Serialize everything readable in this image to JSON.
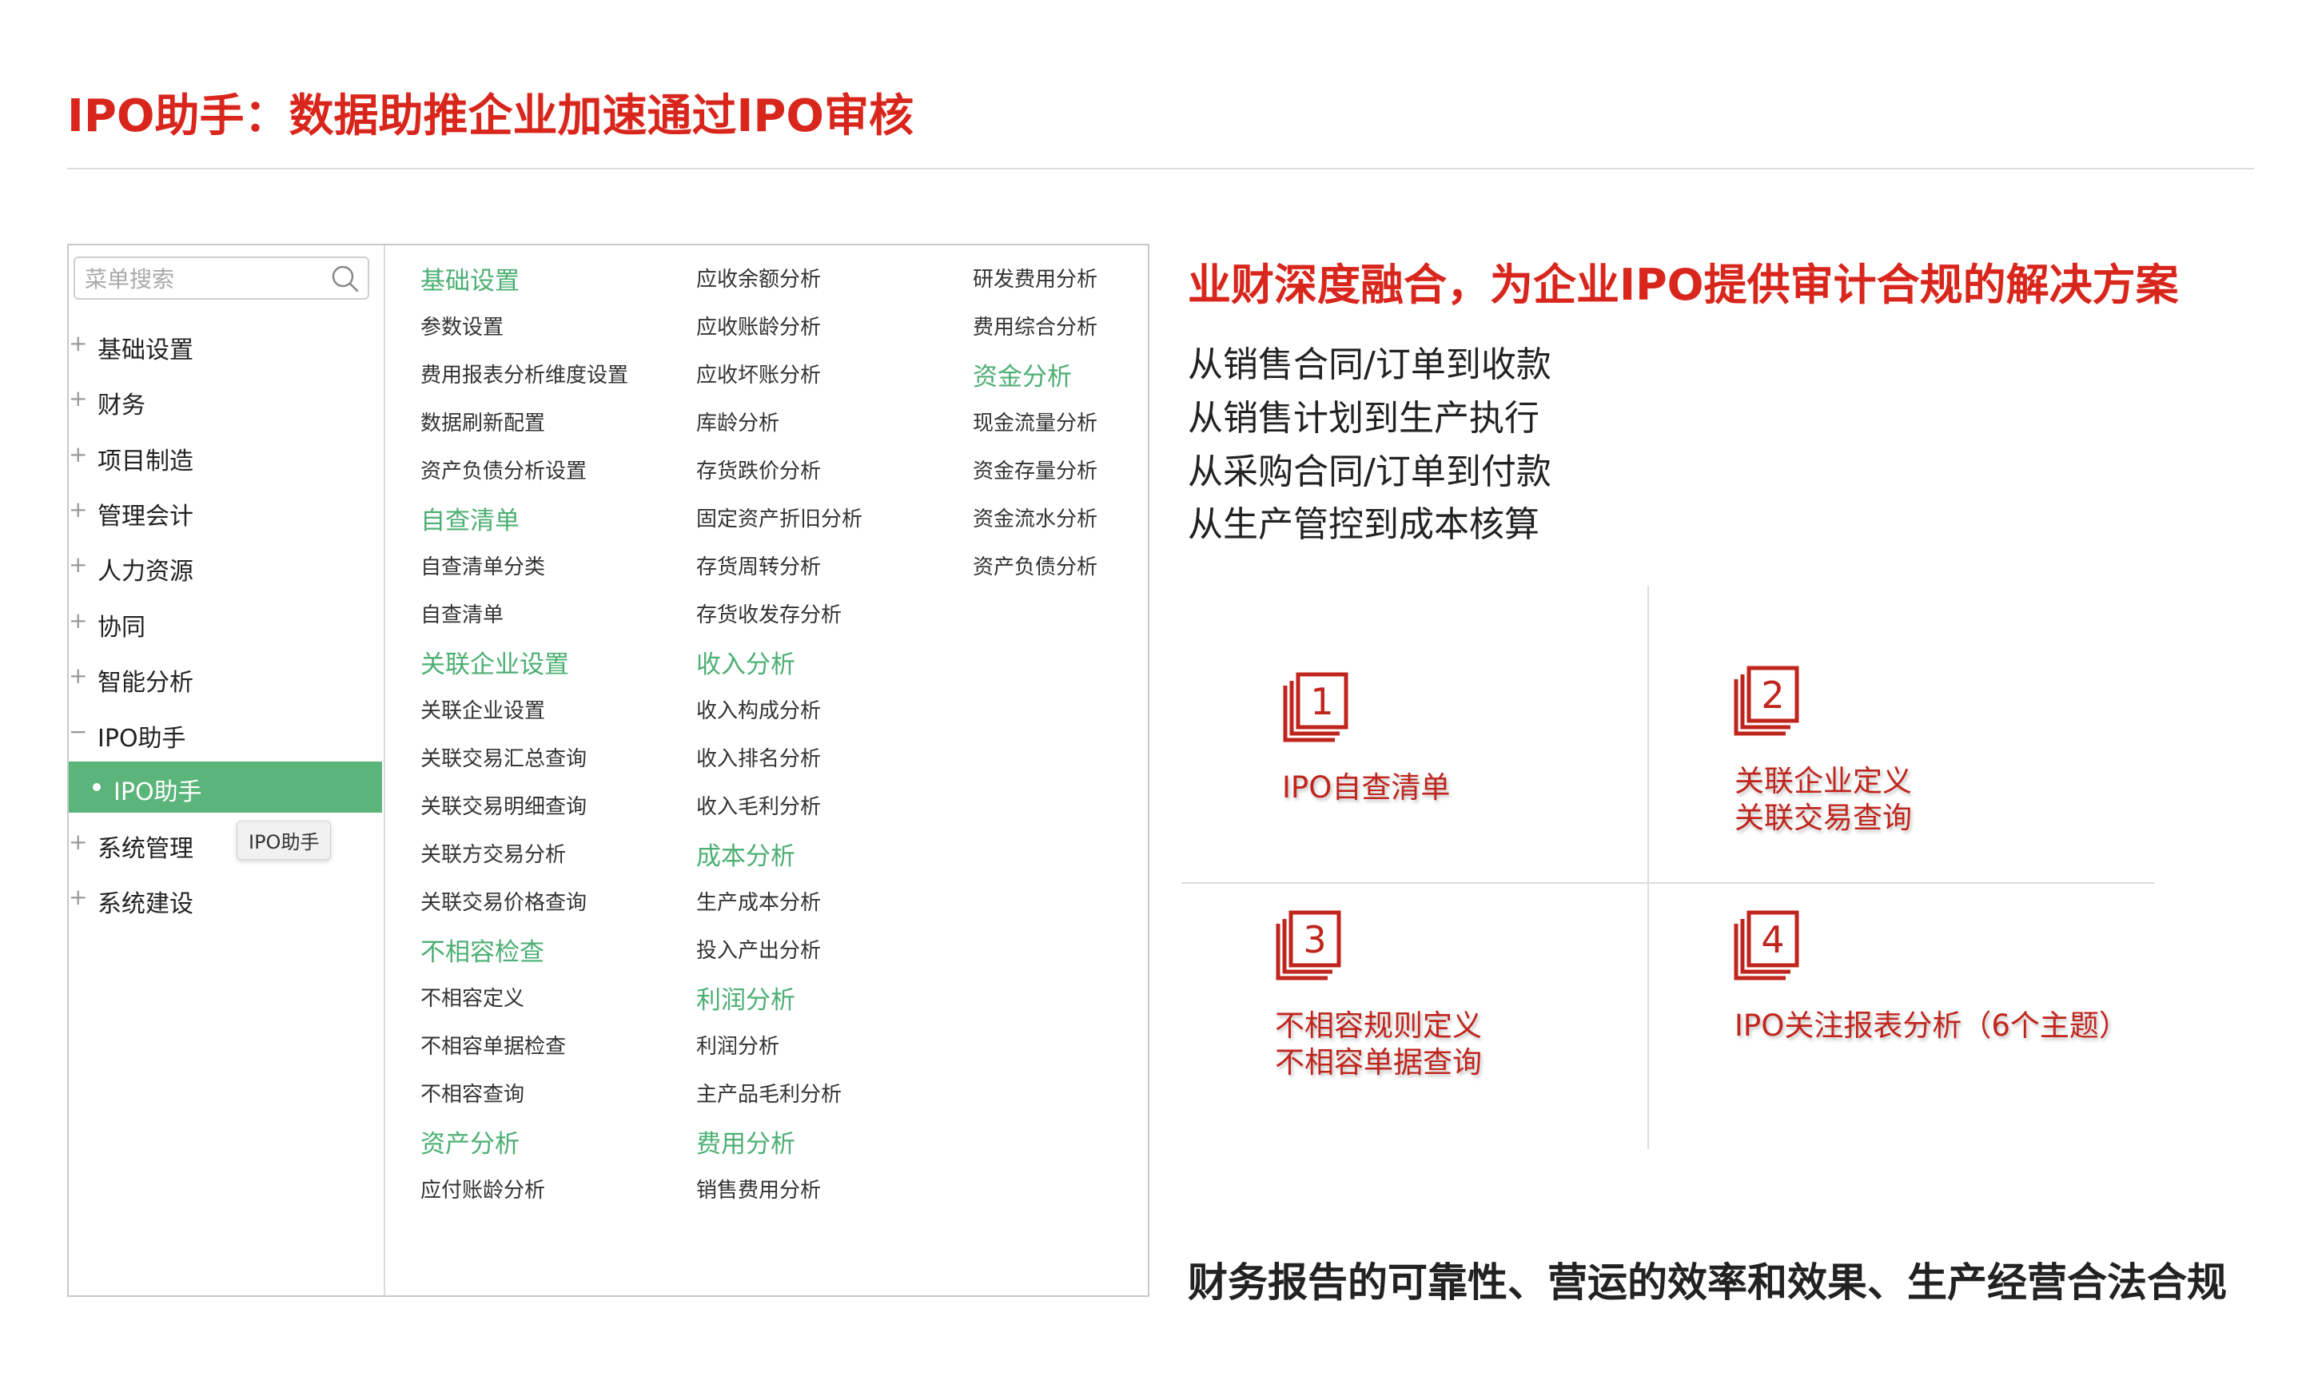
{
  "header": {
    "title": "IPO助手：数据助推企业加速通过IPO审核"
  },
  "sidebar": {
    "search_placeholder": "菜单搜索",
    "items": [
      {
        "prefix": "+",
        "label": "基础设置"
      },
      {
        "prefix": "+",
        "label": "财务"
      },
      {
        "prefix": "+",
        "label": "项目制造"
      },
      {
        "prefix": "+",
        "label": "管理会计"
      },
      {
        "prefix": "+",
        "label": "人力资源"
      },
      {
        "prefix": "+",
        "label": "协同"
      },
      {
        "prefix": "+",
        "label": "智能分析"
      },
      {
        "prefix": "−",
        "label": "IPO助手"
      },
      {
        "prefix": "+",
        "label": "系统管理"
      },
      {
        "prefix": "+",
        "label": "系统建设"
      }
    ],
    "active_sub": "IPO助手",
    "tooltip": "IPO助手"
  },
  "menu": {
    "col1": [
      {
        "t": "h",
        "label": "基础设置"
      },
      {
        "t": "n",
        "label": "参数设置"
      },
      {
        "t": "n",
        "label": "费用报表分析维度设置"
      },
      {
        "t": "n",
        "label": "数据刷新配置"
      },
      {
        "t": "n",
        "label": "资产负债分析设置"
      },
      {
        "t": "h",
        "label": "自查清单"
      },
      {
        "t": "n",
        "label": "自查清单分类"
      },
      {
        "t": "n",
        "label": "自查清单"
      },
      {
        "t": "h",
        "label": "关联企业设置"
      },
      {
        "t": "n",
        "label": "关联企业设置"
      },
      {
        "t": "n",
        "label": "关联交易汇总查询"
      },
      {
        "t": "n",
        "label": "关联交易明细查询"
      },
      {
        "t": "n",
        "label": "关联方交易分析"
      },
      {
        "t": "n",
        "label": "关联交易价格查询"
      },
      {
        "t": "h",
        "label": "不相容检查"
      },
      {
        "t": "n",
        "label": "不相容定义"
      },
      {
        "t": "n",
        "label": "不相容单据检查"
      },
      {
        "t": "n",
        "label": "不相容查询"
      },
      {
        "t": "h",
        "label": "资产分析"
      },
      {
        "t": "n",
        "label": "应付账龄分析"
      }
    ],
    "col2": [
      {
        "t": "n",
        "label": "应收余额分析"
      },
      {
        "t": "n",
        "label": "应收账龄分析"
      },
      {
        "t": "n",
        "label": "应收坏账分析"
      },
      {
        "t": "n",
        "label": "库龄分析"
      },
      {
        "t": "n",
        "label": "存货跌价分析"
      },
      {
        "t": "n",
        "label": "固定资产折旧分析"
      },
      {
        "t": "n",
        "label": "存货周转分析"
      },
      {
        "t": "n",
        "label": "存货收发存分析"
      },
      {
        "t": "h",
        "label": "收入分析"
      },
      {
        "t": "n",
        "label": "收入构成分析"
      },
      {
        "t": "n",
        "label": "收入排名分析"
      },
      {
        "t": "n",
        "label": "收入毛利分析"
      },
      {
        "t": "h",
        "label": "成本分析"
      },
      {
        "t": "n",
        "label": "生产成本分析"
      },
      {
        "t": "n",
        "label": "投入产出分析"
      },
      {
        "t": "h",
        "label": "利润分析"
      },
      {
        "t": "n",
        "label": "利润分析"
      },
      {
        "t": "n",
        "label": "主产品毛利分析"
      },
      {
        "t": "h",
        "label": "费用分析"
      },
      {
        "t": "n",
        "label": "销售费用分析"
      }
    ],
    "col3": [
      {
        "t": "n",
        "label": "研发费用分析"
      },
      {
        "t": "n",
        "label": "费用综合分析"
      },
      {
        "t": "h",
        "label": "资金分析"
      },
      {
        "t": "n",
        "label": "现金流量分析"
      },
      {
        "t": "n",
        "label": "资金存量分析"
      },
      {
        "t": "n",
        "label": "资金流水分析"
      },
      {
        "t": "n",
        "label": "资产负债分析"
      }
    ]
  },
  "right": {
    "subtitle": "业财深度融合，为企业IPO提供审计合规的解决方案",
    "flows": [
      "从销售合同/订单到收款",
      "从销售计划到生产执行",
      "从采购合同/订单到付款",
      "从生产管控到成本核算"
    ],
    "quadrants": [
      {
        "num": "1",
        "lines": [
          "IPO自查清单"
        ]
      },
      {
        "num": "2",
        "lines": [
          "关联企业定义",
          "关联交易查询"
        ]
      },
      {
        "num": "3",
        "lines": [
          "不相容规则定义",
          "不相容单据查询"
        ]
      },
      {
        "num": "4",
        "lines": [
          "IPO关注报表分析（6个主题）"
        ]
      }
    ],
    "footer": "财务报告的可靠性、营运的效率和效果、生产经营合法合规"
  },
  "colors": {
    "accent_red": "#d9261c",
    "menu_green": "#4caf73",
    "active_green": "#5bb57a"
  }
}
